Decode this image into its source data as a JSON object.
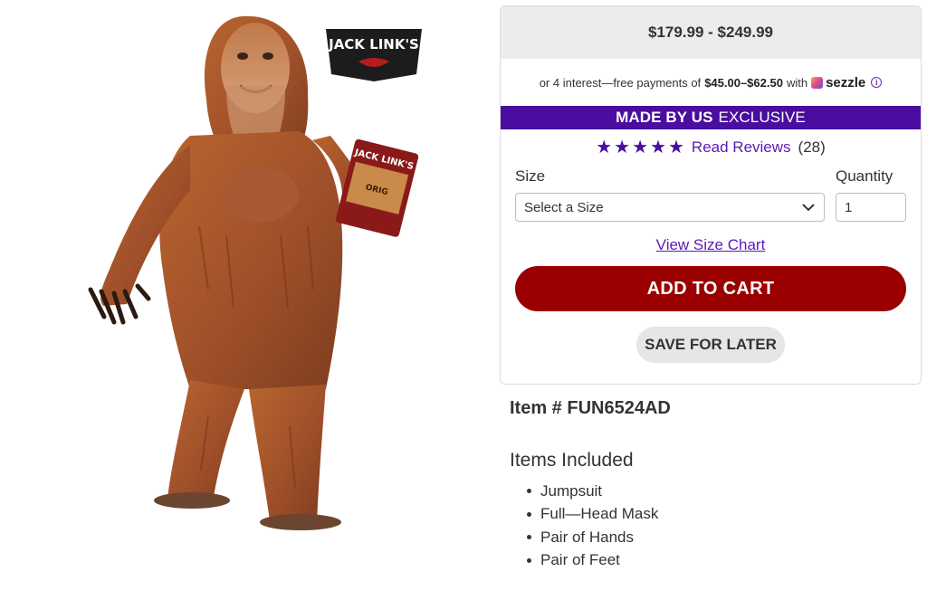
{
  "product_image": {
    "alt_icon": "sasquatch-costume-image",
    "brand_logo_text": "JACK LINK'S"
  },
  "purchase": {
    "price_range": "$179.99 - $249.99",
    "sezzle": {
      "prefix": "or 4 interest—free payments of",
      "amount": "$45.00–$62.50",
      "with": "with",
      "brand": "sezzle",
      "info_icon": "info-icon"
    },
    "exclusive": {
      "strong": "MADE BY US",
      "rest": "EXCLUSIVE"
    },
    "rating": {
      "stars": 5,
      "reviews_label": "Read Reviews",
      "count": "(28)"
    },
    "size_label": "Size",
    "size_select_value": "Select a Size",
    "quantity_label": "Quantity",
    "quantity_value": "1",
    "size_chart_label": "View Size Chart",
    "add_to_cart_label": "ADD TO CART",
    "save_for_later_label": "SAVE FOR LATER"
  },
  "details": {
    "item_number": "Item # FUN6524AD",
    "items_included_title": "Items Included",
    "items": [
      "Jumpsuit",
      "Full—Head Mask",
      "Pair of Hands",
      "Pair of Feet"
    ]
  },
  "colors": {
    "exclusive_bar": "#4a0da0",
    "cart_button": "#9a0000",
    "link": "#5a1ab4",
    "fur": "#a5522a"
  }
}
